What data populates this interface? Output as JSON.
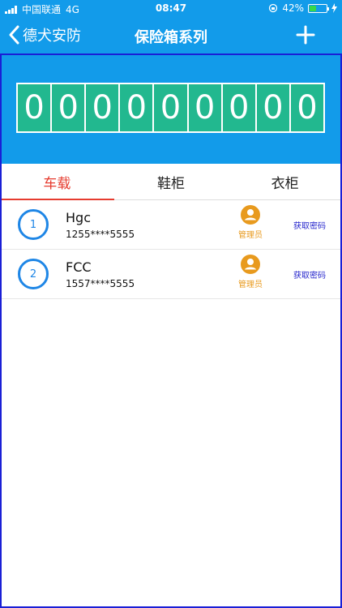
{
  "status_bar": {
    "carrier": "中国联通",
    "network": "4G",
    "time": "08:47",
    "battery_percent": "42%",
    "battery_level": 0.42
  },
  "nav": {
    "back_label": "德犬安防",
    "title": "保险箱系列"
  },
  "counter": {
    "digits": [
      "0",
      "0",
      "0",
      "0",
      "0",
      "0",
      "0",
      "0",
      "0"
    ]
  },
  "tabs": [
    {
      "label": "车载",
      "active": true
    },
    {
      "label": "鞋柜",
      "active": false
    },
    {
      "label": "衣柜",
      "active": false
    }
  ],
  "users": [
    {
      "index": "1",
      "name": "Hgc",
      "phone": "1255****5555",
      "role": "管理员",
      "action": "获取密码"
    },
    {
      "index": "2",
      "name": "FCC",
      "phone": "1557****5555",
      "role": "管理员",
      "action": "获取密码"
    }
  ],
  "colors": {
    "header_blue": "#129bea",
    "digit_green": "#22b88f",
    "tab_active_red": "#e63c2f",
    "role_orange": "#e89a1e",
    "action_blue": "#2525cc",
    "frame_border": "#1a1fd6"
  }
}
